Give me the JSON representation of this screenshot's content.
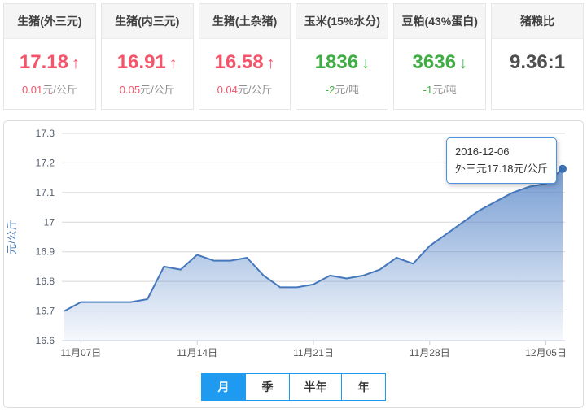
{
  "cards": [
    {
      "title": "生猪(外三元)",
      "value": "17.18",
      "trend": "up",
      "arrow_glyph": "↑",
      "change_value": "0.01",
      "change_unit": "元/公斤"
    },
    {
      "title": "生猪(内三元)",
      "value": "16.91",
      "trend": "up",
      "arrow_glyph": "↑",
      "change_value": "0.05",
      "change_unit": "元/公斤"
    },
    {
      "title": "生猪(土杂猪)",
      "value": "16.58",
      "trend": "up",
      "arrow_glyph": "↑",
      "change_value": "0.04",
      "change_unit": "元/公斤"
    },
    {
      "title": "玉米(15%水分)",
      "value": "1836",
      "trend": "down",
      "arrow_glyph": "↓",
      "change_value": "-2",
      "change_unit": "元/吨"
    },
    {
      "title": "豆粕(43%蛋白)",
      "value": "3636",
      "trend": "down",
      "arrow_glyph": "↓",
      "change_value": "-1",
      "change_unit": "元/吨"
    },
    {
      "title": "猪粮比",
      "value": "9.36:1",
      "trend": "neutral"
    }
  ],
  "tooltip": {
    "date": "2016-12-06",
    "text": "外三元17.18元/公斤"
  },
  "tabs": {
    "items": [
      {
        "label": "月",
        "active": true
      },
      {
        "label": "季",
        "active": false
      },
      {
        "label": "半年",
        "active": false
      },
      {
        "label": "年",
        "active": false
      }
    ]
  },
  "chart_data": {
    "type": "area",
    "title": "",
    "xlabel": "",
    "ylabel": "元/公斤",
    "ylim": [
      16.6,
      17.3
    ],
    "y_step": 0.1,
    "grid": "horizontal",
    "legend": "none",
    "x": [
      "2016-11-06",
      "2016-11-07",
      "2016-11-08",
      "2016-11-09",
      "2016-11-10",
      "2016-11-11",
      "2016-11-12",
      "2016-11-13",
      "2016-11-14",
      "2016-11-15",
      "2016-11-16",
      "2016-11-17",
      "2016-11-18",
      "2016-11-19",
      "2016-11-20",
      "2016-11-21",
      "2016-11-22",
      "2016-11-23",
      "2016-11-24",
      "2016-11-25",
      "2016-11-26",
      "2016-11-27",
      "2016-11-28",
      "2016-11-29",
      "2016-11-30",
      "2016-12-01",
      "2016-12-02",
      "2016-12-03",
      "2016-12-04",
      "2016-12-05",
      "2016-12-06"
    ],
    "x_ticks": [
      {
        "index": 1,
        "label": "11月07日"
      },
      {
        "index": 8,
        "label": "11月14日"
      },
      {
        "index": 15,
        "label": "11月21日"
      },
      {
        "index": 22,
        "label": "11月28日"
      },
      {
        "index": 29,
        "label": "12月05日"
      }
    ],
    "series": [
      {
        "name": "外三元",
        "values": [
          16.7,
          16.73,
          16.73,
          16.73,
          16.73,
          16.74,
          16.85,
          16.84,
          16.89,
          16.87,
          16.87,
          16.88,
          16.82,
          16.78,
          16.78,
          16.79,
          16.82,
          16.81,
          16.82,
          16.84,
          16.88,
          16.86,
          16.92,
          16.96,
          17.0,
          17.04,
          17.07,
          17.1,
          17.12,
          17.13,
          17.18
        ]
      }
    ],
    "last_point": {
      "date": "2016-12-06",
      "value": 17.18
    }
  },
  "colors": {
    "up": "#f4556a",
    "down": "#3fad44",
    "tab_blue": "#1e9bf0",
    "line": "#4477bb",
    "marker": "#3b70b4",
    "area_top": "#4a7dc4",
    "grid_line": "#d8d8d8",
    "axis_line": "#c9d0dc",
    "y_label": "#555f6e",
    "x_label": "#555555",
    "axis_title": "#4a78b0",
    "tooltip_border": "#4f93d6"
  }
}
